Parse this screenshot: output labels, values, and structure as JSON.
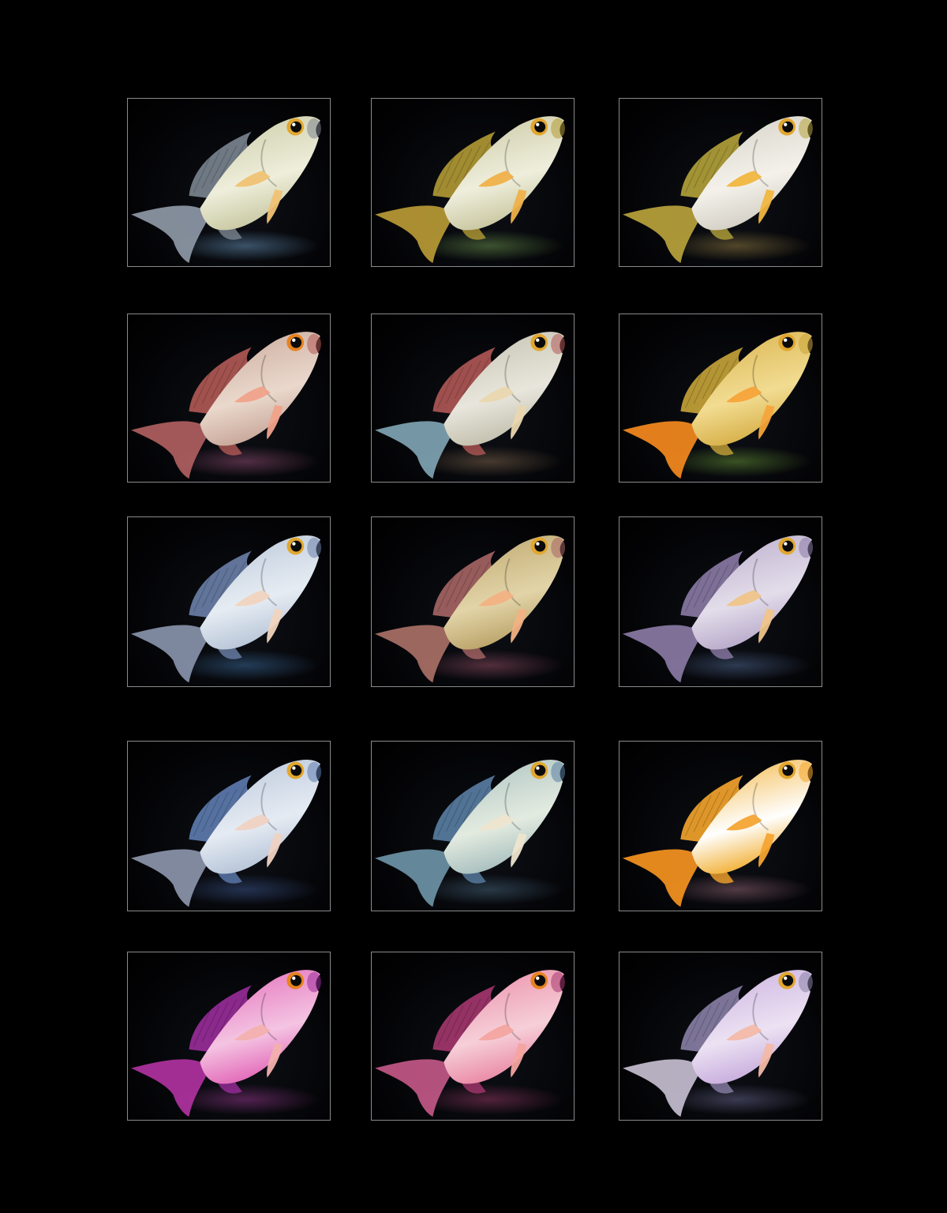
{
  "grid": {
    "rows": 5,
    "columns": 3
  },
  "colors": {
    "background": "#000000",
    "frame": "#8a8a8a"
  },
  "fish": [
    {
      "body": "#c9c9a4",
      "belly": "#eeeedb",
      "fin": "#7b8590",
      "tail": "#8e98a6",
      "pec": "#f0c274",
      "glow": "#4b6a86",
      "eye": "#e1a72f"
    },
    {
      "body": "#c9c7a0",
      "belly": "#efeedc",
      "fin": "#b39a35",
      "tail": "#b89a35",
      "pec": "#efb14a",
      "glow": "#4d6a3a",
      "eye": "#e1a72f"
    },
    {
      "body": "#d4d0c6",
      "belly": "#f4f1ea",
      "fin": "#b4a23a",
      "tail": "#b9a33c",
      "pec": "#f0b640",
      "glow": "#6a5a33",
      "eye": "#e1a72f"
    },
    {
      "body": "#c8a89a",
      "belly": "#ead8cc",
      "fin": "#b35a55",
      "tail": "#b06060",
      "pec": "#f0a28a",
      "glow": "#6a3a55",
      "eye": "#e6831f"
    },
    {
      "body": "#c3c0ae",
      "belly": "#e8e6dc",
      "fin": "#b05855",
      "tail": "#7fa3b2",
      "pec": "#ead7b0",
      "glow": "#5c4a3a",
      "eye": "#e1a72f"
    },
    {
      "body": "#d8b14a",
      "belly": "#f2dc92",
      "fin": "#c8a438",
      "tail": "#f58a1e",
      "pec": "#f5a43a",
      "glow": "#4a6a2a",
      "eye": "#e1a72f"
    },
    {
      "body": "#b8c6d8",
      "belly": "#e6ecf3",
      "fin": "#6c7fa8",
      "tail": "#8893aa",
      "pec": "#f0d4bf",
      "glow": "#2c4d70",
      "eye": "#e1a72f"
    },
    {
      "body": "#bca46a",
      "belly": "#e2d4a8",
      "fin": "#a76565",
      "tail": "#a97066",
      "pec": "#f2b283",
      "glow": "#6a3a4a",
      "eye": "#e1a72f"
    },
    {
      "body": "#b9abcb",
      "belly": "#e3ddea",
      "fin": "#8b7aa5",
      "tail": "#8a7aa4",
      "pec": "#f0c48a",
      "glow": "#3a4a68",
      "eye": "#e1a72f"
    },
    {
      "body": "#b7c5d8",
      "belly": "#e5ebf3",
      "fin": "#5e7cb0",
      "tail": "#8b95aa",
      "pec": "#efd2c2",
      "glow": "#2c3e66",
      "eye": "#e1a72f"
    },
    {
      "body": "#a9c0bf",
      "belly": "#e3ebe0",
      "fin": "#5a7ea3",
      "tail": "#6c93a6",
      "pec": "#eee5cf",
      "glow": "#33485a",
      "eye": "#e1a72f"
    },
    {
      "body": "#f2b23a",
      "belly": "#ffffff",
      "fin": "#f6a52c",
      "tail": "#f6941f",
      "pec": "#f5a431",
      "glow": "#6a4a55",
      "eye": "#e1a72f"
    },
    {
      "body": "#e36ab9",
      "belly": "#f4c4e2",
      "fin": "#9a2c9a",
      "tail": "#b0329f",
      "pec": "#f2b0ae",
      "glow": "#6a2a66",
      "eye": "#e6831f"
    },
    {
      "body": "#ea8aa6",
      "belly": "#f6cfd8",
      "fin": "#a5366e",
      "tail": "#c25887",
      "pec": "#f3a4a0",
      "glow": "#6a2a4a",
      "eye": "#e6831f"
    },
    {
      "body": "#c9aede",
      "belly": "#ece2f3",
      "fin": "#8a80a6",
      "tail": "#c6bed0",
      "pec": "#f3b9a8",
      "glow": "#4a4a66",
      "eye": "#e1a72f"
    }
  ]
}
